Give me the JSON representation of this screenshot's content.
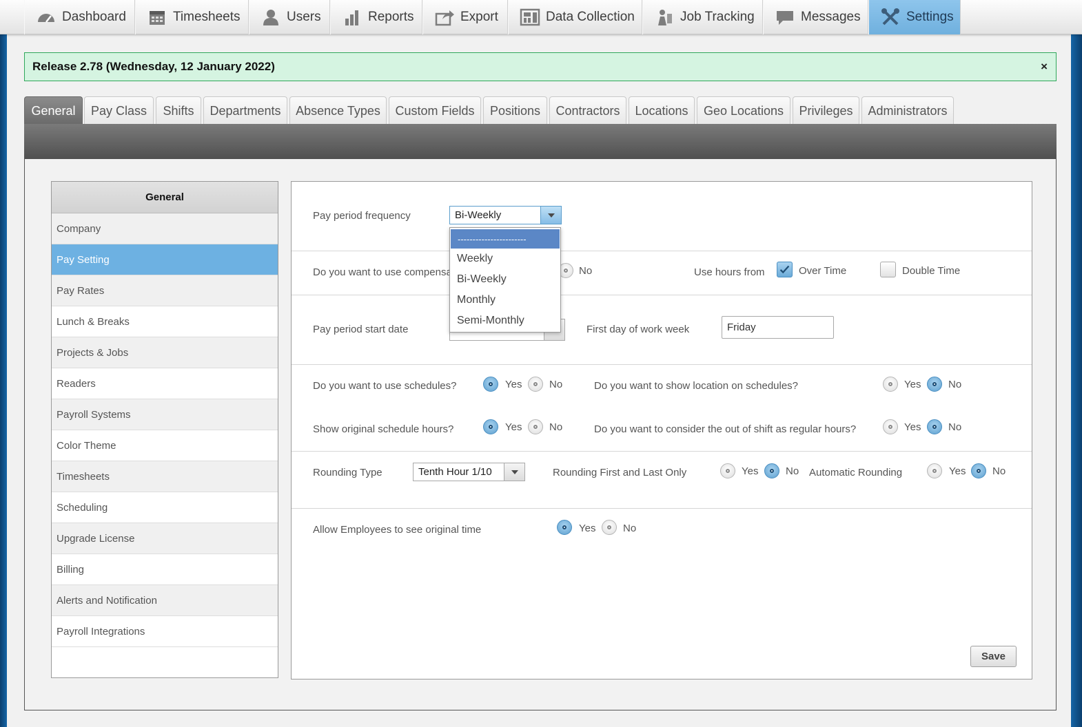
{
  "nav": [
    {
      "label": "Dashboard",
      "icon": "dashboard-icon"
    },
    {
      "label": "Timesheets",
      "icon": "calendar-icon"
    },
    {
      "label": "Users",
      "icon": "user-icon"
    },
    {
      "label": "Reports",
      "icon": "bar-chart-icon"
    },
    {
      "label": "Export",
      "icon": "export-icon"
    },
    {
      "label": "Data Collection",
      "icon": "data-collection-icon"
    },
    {
      "label": "Job Tracking",
      "icon": "job-tracking-icon"
    },
    {
      "label": "Messages",
      "icon": "chat-bubble-icon"
    },
    {
      "label": "Settings",
      "icon": "tools-icon"
    }
  ],
  "banner": {
    "text": "Release 2.78 (Wednesday, 12 January 2022)",
    "close": "×"
  },
  "tabs": [
    "General",
    "Pay Class",
    "Shifts",
    "Departments",
    "Absence Types",
    "Custom Fields",
    "Positions",
    "Contractors",
    "Locations",
    "Geo Locations",
    "Privileges",
    "Administrators"
  ],
  "sidebar": {
    "title": "General",
    "items": [
      "Company",
      "Pay Setting",
      "Pay Rates",
      "Lunch & Breaks",
      "Projects & Jobs",
      "Readers",
      "Payroll Systems",
      "Color Theme",
      "Timesheets",
      "Scheduling",
      "Upgrade License",
      "Billing",
      "Alerts and Notification",
      "Payroll Integrations"
    ],
    "active": "Pay Setting"
  },
  "form": {
    "pay_period_frequency": {
      "label": "Pay period frequency",
      "value": "Bi-Weekly"
    },
    "dropdown_options": [
      "-----------------------",
      "Weekly",
      "Bi-Weekly",
      "Monthly",
      "Semi-Monthly"
    ],
    "compensation": {
      "label": "Do you want to use compensa",
      "no": "No"
    },
    "use_hours_from": {
      "label": "Use hours from",
      "over_time": "Over Time",
      "double_time": "Double Time",
      "over_time_checked": true,
      "double_time_checked": false
    },
    "pay_period_start": {
      "label": "Pay period start date"
    },
    "first_day": {
      "label": "First day of work week",
      "value": "Friday"
    },
    "schedules": {
      "label": "Do you want to use schedules?",
      "yes": "Yes",
      "no": "No",
      "selected": "Yes"
    },
    "show_location": {
      "label": "Do you want to show location on schedules?",
      "yes": "Yes",
      "no": "No",
      "selected": "No"
    },
    "original_hours": {
      "label": "Show original schedule hours?",
      "yes": "Yes",
      "no": "No",
      "selected": "Yes"
    },
    "out_of_shift": {
      "label": "Do you want to consider the out of shift as regular hours?",
      "yes": "Yes",
      "no": "No",
      "selected": "No"
    },
    "rounding_type": {
      "label": "Rounding Type",
      "value": "Tenth Hour 1/10"
    },
    "rounding_first_last": {
      "label": "Rounding First and Last Only",
      "yes": "Yes",
      "no": "No",
      "selected": "No"
    },
    "automatic_rounding": {
      "label": "Automatic Rounding",
      "yes": "Yes",
      "no": "No",
      "selected": "No"
    },
    "see_original_time": {
      "label": "Allow Employees to see original time",
      "yes": "Yes",
      "no": "No",
      "selected": "Yes"
    },
    "save": "Save"
  }
}
